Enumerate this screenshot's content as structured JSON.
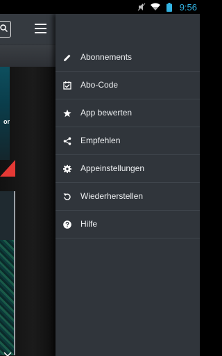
{
  "status_bar": {
    "time": "9:56",
    "icons": [
      "mute-icon",
      "wifi-icon",
      "battery-icon"
    ]
  },
  "background_app": {
    "cover_text": "or",
    "accent_color": "#e53935"
  },
  "drawer": {
    "items": [
      {
        "label": "Abonnements",
        "icon": "pencil-icon"
      },
      {
        "label": "Abo-Code",
        "icon": "checkbox-icon"
      },
      {
        "label": "App bewerten",
        "icon": "star-icon"
      },
      {
        "label": "Empfehlen",
        "icon": "share-icon"
      },
      {
        "label": "Appeinstellungen",
        "icon": "gear-icon"
      },
      {
        "label": "Wiederherstellen",
        "icon": "restore-icon"
      },
      {
        "label": "Hilfe",
        "icon": "help-icon"
      }
    ]
  },
  "colors": {
    "drawer_bg": "#30353b",
    "status_time": "#33b5e5",
    "toolbar": "#353a40"
  }
}
